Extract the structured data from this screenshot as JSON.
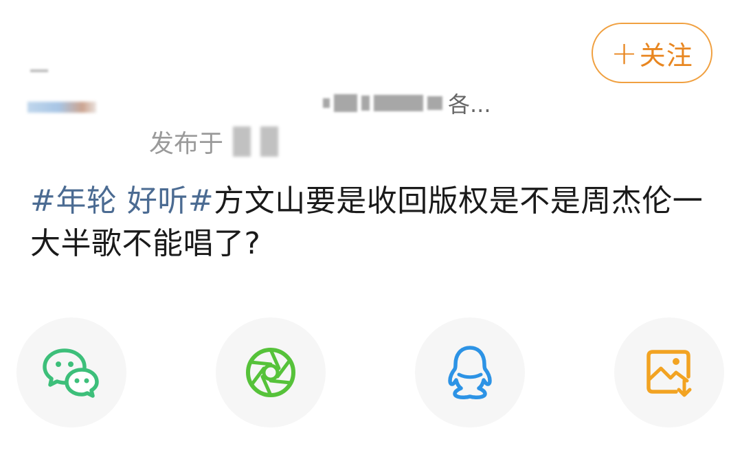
{
  "header": {
    "follow_label": "关注",
    "follow_plus": "+",
    "username_suffix": "各...",
    "meta_label": "发布于",
    "follow_color": "#e88620"
  },
  "post": {
    "hashtag": "#年轮 好听#",
    "body_line": "方文山要是收回版权是不是周杰伦一大半歌不能唱了?"
  },
  "share": {
    "items": [
      {
        "icon": "wechat-icon",
        "color": "#3dbf7a"
      },
      {
        "icon": "moments-icon",
        "color": "#56c23a"
      },
      {
        "icon": "qq-icon",
        "color": "#2d93e5"
      },
      {
        "icon": "save-image-icon",
        "color": "#f2a322"
      }
    ]
  }
}
